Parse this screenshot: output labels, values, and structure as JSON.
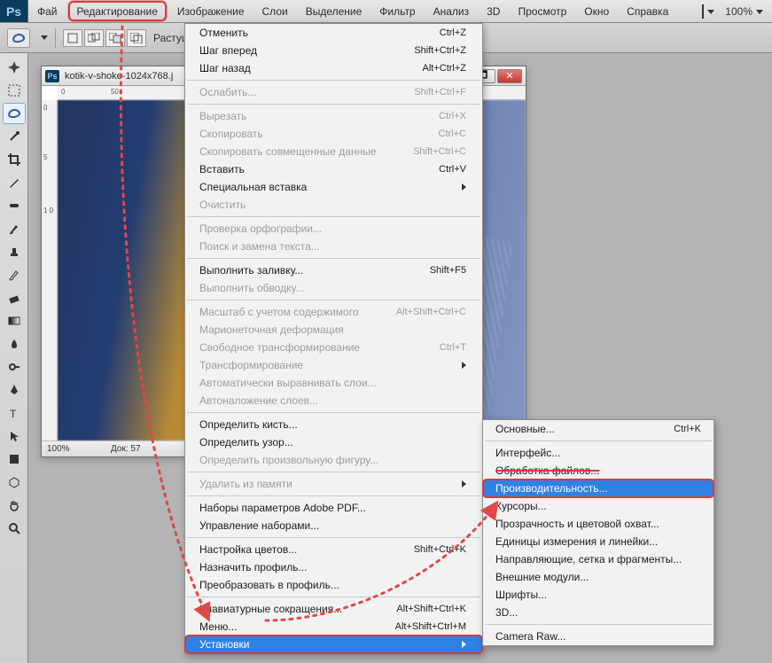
{
  "menubar": {
    "logo": "Ps",
    "items": [
      "Фай",
      "Редактирование",
      "Изображение",
      "Слои",
      "Выделение",
      "Фильтр",
      "Анализ",
      "3D",
      "Просмотр",
      "Окно",
      "Справка"
    ],
    "zoom": "100%"
  },
  "optionsbar": {
    "feather_label": "Растуш"
  },
  "toolbox": {
    "tools": [
      "move-tool",
      "marquee-tool",
      "lasso-tool",
      "wand-tool",
      "crop-tool",
      "eyedropper-tool",
      "healing-tool",
      "brush-tool",
      "stamp-tool",
      "history-brush-tool",
      "eraser-tool",
      "gradient-tool",
      "blur-tool",
      "dodge-tool",
      "pen-tool",
      "type-tool",
      "path-select-tool",
      "shape-tool",
      "3d-tool",
      "hand-tool",
      "zoom-tool"
    ],
    "active_index": 2
  },
  "document": {
    "title": "kotik-v-shoke-1024x768.j",
    "ruler_h": [
      "0",
      "50"
    ],
    "ruler_v": [
      "0",
      "5",
      "1 0"
    ],
    "status": {
      "zoom": "100%",
      "doc": "Док: 57"
    }
  },
  "edit_menu": {
    "groups": [
      [
        {
          "label": "Отменить",
          "short": "Ctrl+Z",
          "enabled": true
        },
        {
          "label": "Шаг вперед",
          "short": "Shift+Ctrl+Z",
          "enabled": true
        },
        {
          "label": "Шаг назад",
          "short": "Alt+Ctrl+Z",
          "enabled": true
        }
      ],
      [
        {
          "label": "Ослабить...",
          "short": "Shift+Ctrl+F",
          "enabled": false
        }
      ],
      [
        {
          "label": "Вырезать",
          "short": "Ctrl+X",
          "enabled": false
        },
        {
          "label": "Скопировать",
          "short": "Ctrl+C",
          "enabled": false
        },
        {
          "label": "Скопировать совмещенные данные",
          "short": "Shift+Ctrl+C",
          "enabled": false
        },
        {
          "label": "Вставить",
          "short": "Ctrl+V",
          "enabled": true
        },
        {
          "label": "Специальная вставка",
          "submenu": true,
          "enabled": true
        },
        {
          "label": "Очистить",
          "enabled": false
        }
      ],
      [
        {
          "label": "Проверка орфографии...",
          "enabled": false
        },
        {
          "label": "Поиск и замена текста...",
          "enabled": false
        }
      ],
      [
        {
          "label": "Выполнить заливку...",
          "short": "Shift+F5",
          "enabled": true
        },
        {
          "label": "Выполнить обводку...",
          "enabled": false
        }
      ],
      [
        {
          "label": "Масштаб с учетом содержимого",
          "short": "Alt+Shift+Ctrl+C",
          "enabled": false
        },
        {
          "label": "Марионеточная деформация",
          "enabled": false
        },
        {
          "label": "Свободное трансформирование",
          "short": "Ctrl+T",
          "enabled": false
        },
        {
          "label": "Трансформирование",
          "submenu": true,
          "enabled": false
        },
        {
          "label": "Автоматически выравнивать слои...",
          "enabled": false
        },
        {
          "label": "Автоналожение слоев...",
          "enabled": false
        }
      ],
      [
        {
          "label": "Определить кисть...",
          "enabled": true
        },
        {
          "label": "Определить узор...",
          "enabled": true
        },
        {
          "label": "Определить произвольную фигуру...",
          "enabled": false
        }
      ],
      [
        {
          "label": "Удалить из памяти",
          "submenu": true,
          "enabled": false
        }
      ],
      [
        {
          "label": "Наборы параметров Adobe PDF...",
          "enabled": true
        },
        {
          "label": "Управление наборами...",
          "enabled": true
        }
      ],
      [
        {
          "label": "Настройка цветов...",
          "short": "Shift+Ctrl+K",
          "enabled": true
        },
        {
          "label": "Назначить профиль...",
          "enabled": true
        },
        {
          "label": "Преобразовать в профиль...",
          "enabled": true
        }
      ],
      [
        {
          "label": "Клавиатурные сокращения...",
          "short": "Alt+Shift+Ctrl+K",
          "enabled": true
        },
        {
          "label": "Меню...",
          "short": "Alt+Shift+Ctrl+M",
          "enabled": true
        },
        {
          "label": "Установки",
          "submenu": true,
          "enabled": true,
          "selected": true,
          "boxed": true
        }
      ]
    ]
  },
  "prefs_submenu": {
    "groups": [
      [
        {
          "label": "Основные...",
          "short": "Ctrl+K"
        }
      ],
      [
        {
          "label": "Интерфейс..."
        },
        {
          "label": "Обработка файлов...",
          "strike": true
        },
        {
          "label": "Производительность...",
          "highlighted": true,
          "boxed": true
        },
        {
          "label": "Курсоры..."
        },
        {
          "label": "Прозрачность и цветовой охват..."
        },
        {
          "label": "Единицы измерения и линейки..."
        },
        {
          "label": "Направляющие, сетка и фрагменты..."
        },
        {
          "label": "Внешние модули..."
        },
        {
          "label": "Шрифты..."
        },
        {
          "label": "3D..."
        }
      ],
      [
        {
          "label": "Camera Raw..."
        }
      ]
    ]
  },
  "annotation": {
    "color": "#e04848"
  }
}
